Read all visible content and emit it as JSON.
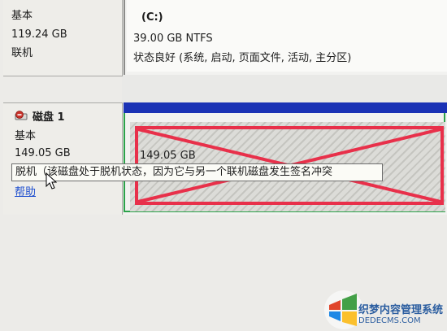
{
  "disk_top": {
    "type": "基本",
    "size": "119.24 GB",
    "status": "联机"
  },
  "partition_c": {
    "label": "(C:)",
    "size_fs": "39.00 GB NTFS",
    "status": "状态良好 (系统, 启动, 页面文件, 活动, 主分区)"
  },
  "disk1": {
    "name": "磁盘 1",
    "type": "基本",
    "size": "149.05 GB",
    "help": "帮助"
  },
  "partition_disk1": {
    "size": "149.05 GB"
  },
  "tooltip": {
    "text": "脱机（该磁盘处于脱机状态，因为它与另一个联机磁盘发生签名冲突"
  },
  "watermark": {
    "line1": "织梦内容管理系统",
    "line2": "DEDECMS.COM"
  },
  "colors": {
    "bar_blue": "#1a32b5",
    "frame_green": "#2ca24a",
    "annotation_red": "#e8304a",
    "link_blue": "#1f4fcf"
  },
  "icons": {
    "disk": "offline-disk-icon",
    "cursor": "mouse-pointer-icon",
    "watermark": "windows-logo-icon"
  }
}
